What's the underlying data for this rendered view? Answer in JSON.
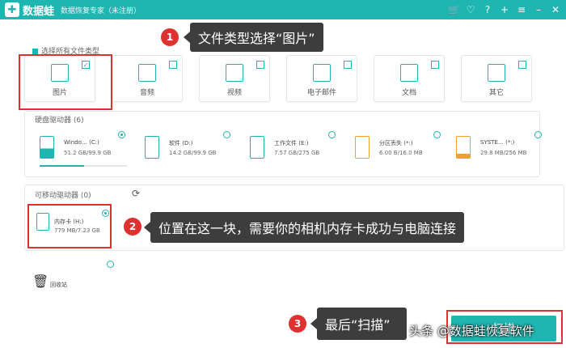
{
  "app": {
    "name": "数据蛙",
    "subtitle": "数据恢复专家（未注册）"
  },
  "titlebar_icons": [
    "cart-icon",
    "heart-icon",
    "help-icon",
    "plus-icon",
    "menu-icon",
    "minimize-icon",
    "close-icon"
  ],
  "file_types": {
    "select_all_label": "选择所有文件类型",
    "items": [
      {
        "label": "图片",
        "checked": true,
        "icon": "image-icon"
      },
      {
        "label": "音频",
        "checked": false,
        "icon": "music-icon"
      },
      {
        "label": "视频",
        "checked": false,
        "icon": "video-icon"
      },
      {
        "label": "电子邮件",
        "checked": false,
        "icon": "email-icon"
      },
      {
        "label": "文档",
        "checked": false,
        "icon": "document-icon"
      },
      {
        "label": "其它",
        "checked": false,
        "icon": "other-icon"
      }
    ]
  },
  "hard_drives": {
    "label": "硬盘驱动器 (6)",
    "items": [
      {
        "name": "Windo… (C:)",
        "size": "51.2 GB/99.9 GB",
        "selected": true,
        "usage": 0.51
      },
      {
        "name": "软件 (D:)",
        "size": "14.2 GB/99.9 GB",
        "selected": false,
        "usage": 0.14
      },
      {
        "name": "工作文件 (E:)",
        "size": "7.57 GB/275 GB",
        "selected": false,
        "usage": 0.03
      },
      {
        "name": "分区丢失 (*:)",
        "size": "6.00 B/16.0 MB",
        "selected": false,
        "usage": 0.0
      },
      {
        "name": "SYSTE… (*:)",
        "size": "29.8 MB/256 MB",
        "selected": false,
        "usage": 0.12
      }
    ]
  },
  "removable": {
    "label": "可移动驱动器 (0)",
    "items": [
      {
        "name": "内存卡 (H:)",
        "size": "779 MB/7.23 GB",
        "selected": true
      }
    ]
  },
  "recycle_bin": {
    "label": "回收站"
  },
  "callouts": [
    {
      "num": "1",
      "text": "文件类型选择“图片”"
    },
    {
      "num": "2",
      "text": "位置在这一块，需要你的相机内存卡成功与电脑连接"
    },
    {
      "num": "3",
      "text": "最后“扫描”"
    }
  ],
  "scan_button": {
    "label": "扫描"
  },
  "watermark": "头条 @数据蛙恢复软件",
  "colors": {
    "accent": "#1fb5b0",
    "highlight": "#e03131",
    "callout_bg": "#3d3d3d"
  }
}
